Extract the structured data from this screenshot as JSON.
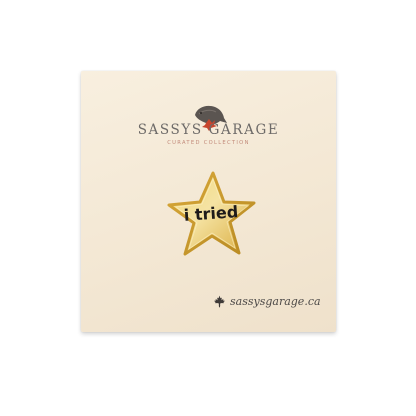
{
  "card": {
    "brand_title": "SASSYS GARAGE",
    "brand_subtitle": "CURATED COLLECTION",
    "pin_text": "i tried",
    "website": "sassysgarage.ca"
  },
  "icons": {
    "logo": "bird-on-maple-leaf-logo",
    "footer": "maple-leaf-icon"
  },
  "colors": {
    "card_background": "#f3e7d3",
    "pin_gold": "#e9c253",
    "maple_red": "#c8452d",
    "brand_text": "#6d6a68"
  }
}
